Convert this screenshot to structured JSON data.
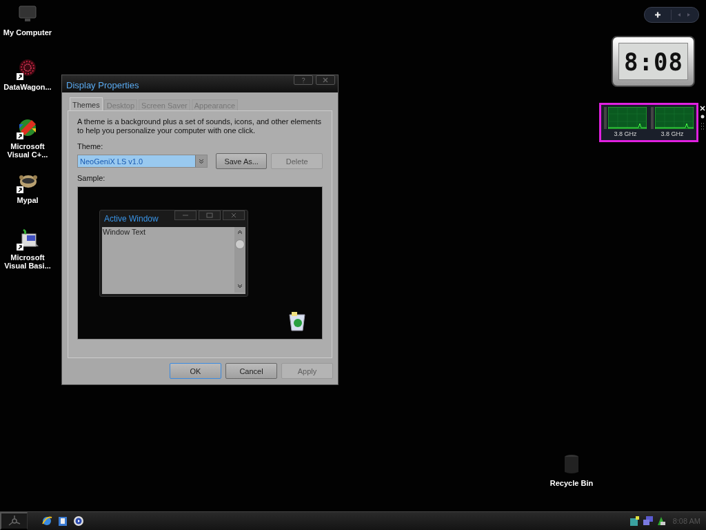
{
  "desktop_icons": [
    {
      "label": "My Computer",
      "kind": "monitor",
      "shortcut": false
    },
    {
      "label": "DataWagon...",
      "kind": "web",
      "shortcut": true
    },
    {
      "label": "Microsoft Visual C+...",
      "kind": "studio",
      "shortcut": true
    },
    {
      "label": "Mypal",
      "kind": "raccoon",
      "shortcut": true
    },
    {
      "label": "Microsoft Visual Basi...",
      "kind": "basic",
      "shortcut": true
    }
  ],
  "recycle_bin": {
    "label": "Recycle Bin"
  },
  "window": {
    "title": "Display Properties",
    "tabs": [
      {
        "label": "Themes",
        "selected": true
      },
      {
        "label": "Desktop",
        "selected": false
      },
      {
        "label": "Screen Saver",
        "selected": false
      },
      {
        "label": "Appearance",
        "selected": false
      }
    ],
    "description": "A theme is a background plus a set of sounds, icons, and other elements to help you personalize your computer with one click.",
    "theme_label": "Theme:",
    "theme_value": "NeoGeniX LS v1.0",
    "theme_buttons": [
      {
        "label": "Save As...",
        "disabled": false
      },
      {
        "label": "Delete",
        "disabled": true
      }
    ],
    "sample_label": "Sample:",
    "sample_window": {
      "title": "Active Window",
      "text": "Window Text"
    },
    "buttons": [
      {
        "label": "OK",
        "disabled": false
      },
      {
        "label": "Cancel",
        "disabled": false
      },
      {
        "label": "Apply",
        "disabled": true
      }
    ]
  },
  "gadgets": {
    "clock": {
      "time": "8:08"
    },
    "cpu": [
      {
        "reading": "3.8 GHz"
      },
      {
        "reading": "3.8 GHz"
      }
    ]
  },
  "taskbar": {
    "clock": "8:08 AM"
  }
}
